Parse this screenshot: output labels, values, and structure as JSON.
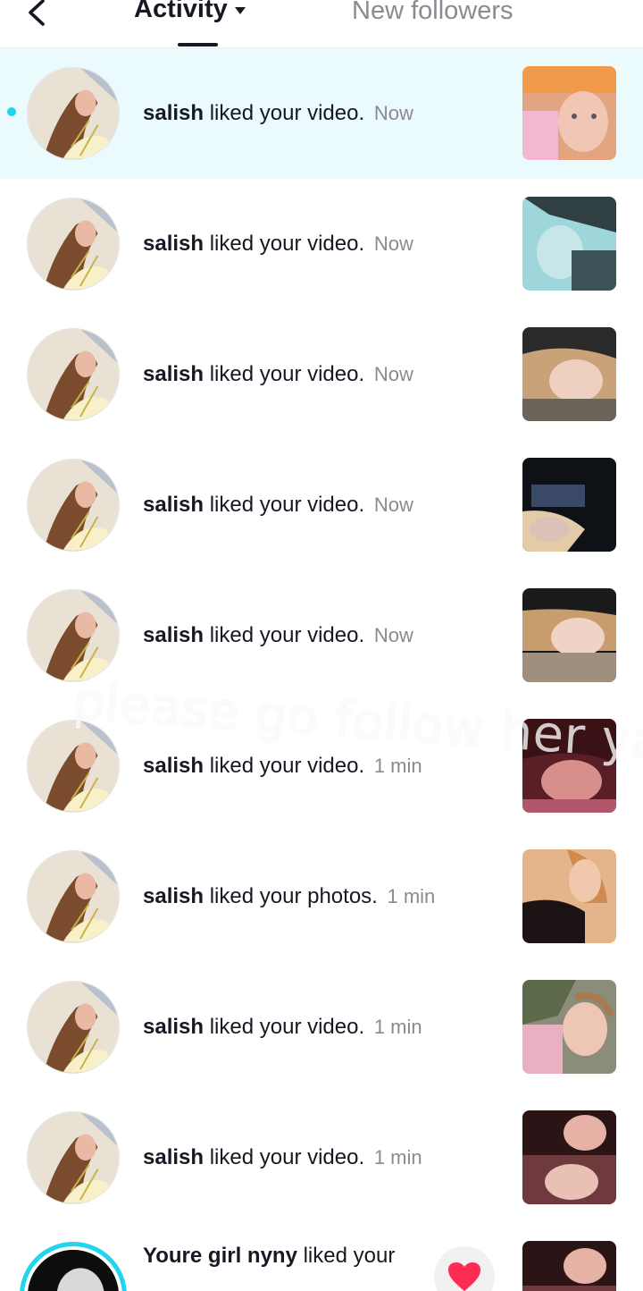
{
  "header": {
    "tab_activity": "Activity",
    "tab_followers": "New followers"
  },
  "notifications": [
    {
      "user": "salish",
      "action": "liked your video.",
      "time": "Now",
      "unread": true
    },
    {
      "user": "salish",
      "action": "liked your video.",
      "time": "Now"
    },
    {
      "user": "salish",
      "action": "liked your video.",
      "time": "Now"
    },
    {
      "user": "salish",
      "action": "liked your video.",
      "time": "Now"
    },
    {
      "user": "salish",
      "action": "liked your video.",
      "time": "Now"
    },
    {
      "user": "salish",
      "action": "liked your video.",
      "time": "1 min"
    },
    {
      "user": "salish",
      "action": "liked your photos.",
      "time": "1 min"
    },
    {
      "user": "salish",
      "action": "liked your video.",
      "time": "1 min"
    },
    {
      "user": "salish",
      "action": "liked your video.",
      "time": "1 min"
    },
    {
      "user": "Youre girl nyny",
      "action": "liked your",
      "time": ""
    }
  ],
  "overlay_caption": "please go follow her yall",
  "colors": {
    "accent_cyan": "#20d5ec",
    "unread_bg": "#eafafd",
    "heart": "#fe2c55"
  }
}
